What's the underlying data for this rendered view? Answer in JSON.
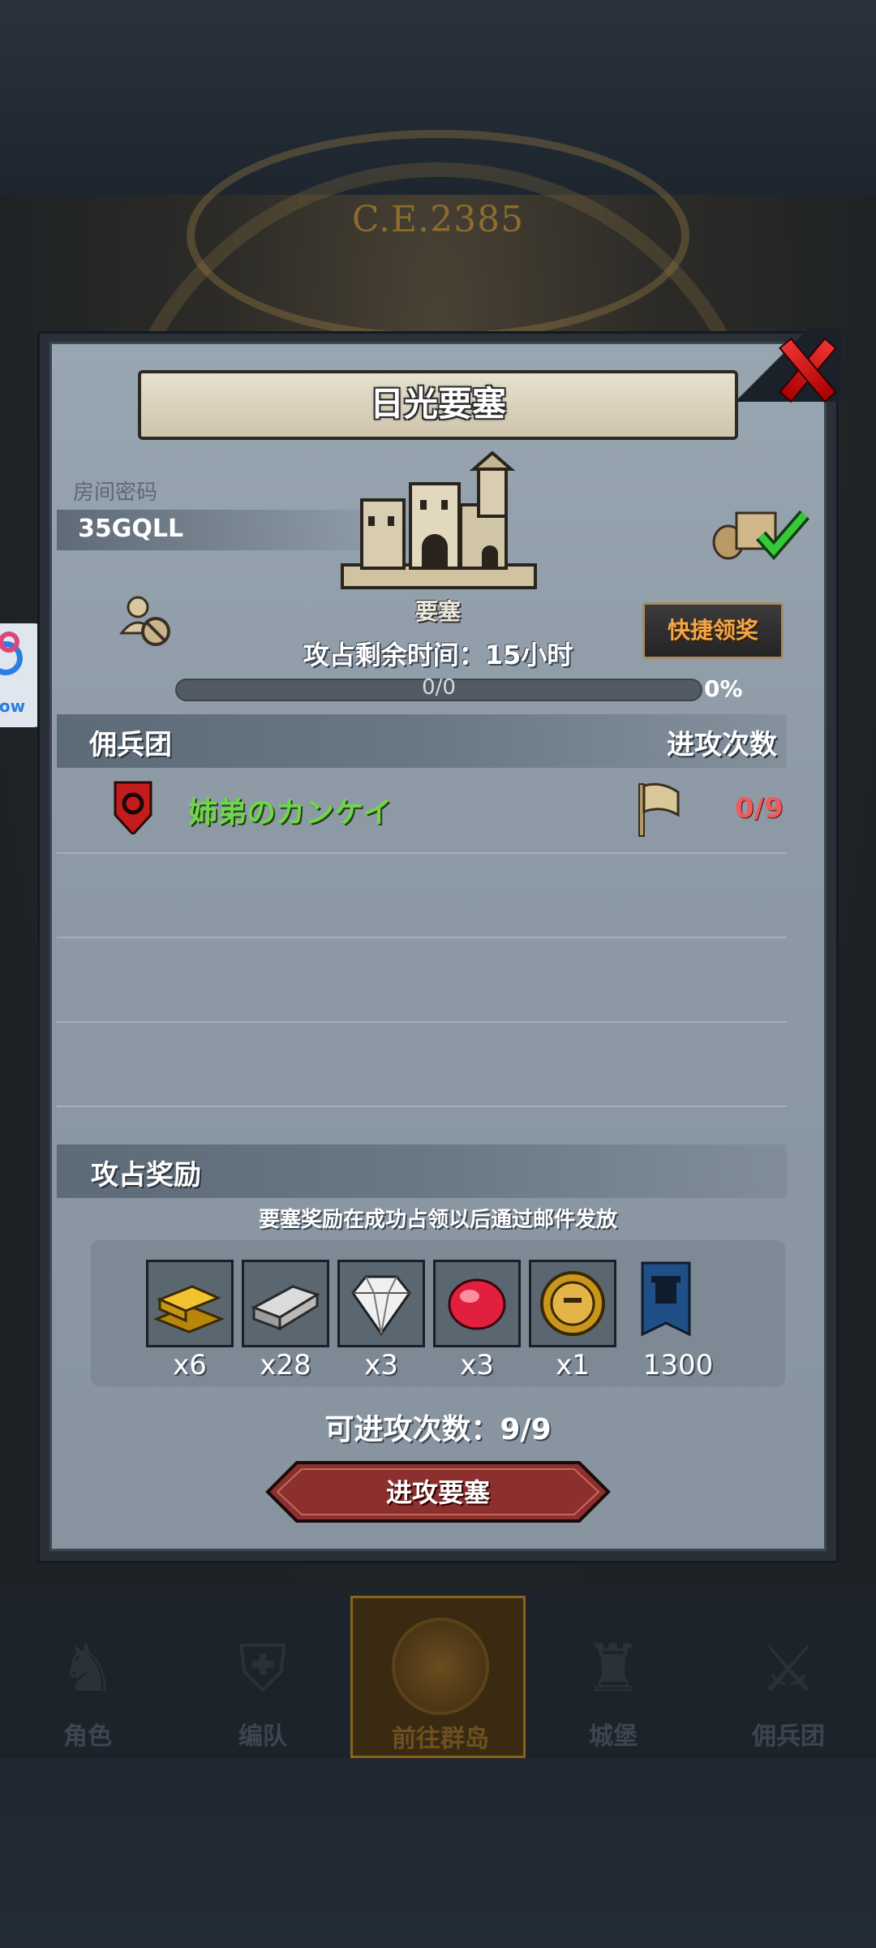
{
  "background": {
    "era_text": "C.E.2385",
    "side_button_text": "low"
  },
  "dialog": {
    "title": "日光要塞",
    "room": {
      "label": "房间密码",
      "code": "35GQLL"
    },
    "fortress_label": "要塞",
    "quick_claim_label": "快捷领奖",
    "remaining_time": "攻占剩余时间：15小时",
    "progress": {
      "text": "0/0",
      "percent_label": "0%",
      "fraction": 0
    },
    "mercenary_section": {
      "title": "佣兵团",
      "attack_count_header": "进攻次数",
      "rows": [
        {
          "name": "姉弟のカンケイ",
          "attacks": "0/9"
        }
      ]
    },
    "reward_section": {
      "title": "攻占奖励",
      "note": "要塞奖励在成功占领以后通过邮件发放",
      "items": [
        {
          "icon": "gold-bar-icon",
          "qty": "x6"
        },
        {
          "icon": "silver-bar-icon",
          "qty": "x28"
        },
        {
          "icon": "diamond-icon",
          "qty": "x3"
        },
        {
          "icon": "ruby-icon",
          "qty": "x3"
        },
        {
          "icon": "knight-coin-icon",
          "qty": "x1"
        },
        {
          "icon": "castle-banner-icon",
          "qty": "1300"
        }
      ]
    },
    "available_attacks": "可进攻次数：9/9",
    "attack_button_label": "进攻要塞"
  },
  "nav": {
    "items": [
      {
        "label": "角色",
        "active": false
      },
      {
        "label": "编队",
        "active": false
      },
      {
        "label": "前往群岛",
        "active": true
      },
      {
        "label": "城堡",
        "active": false
      },
      {
        "label": "佣兵团",
        "active": false
      }
    ]
  },
  "colors": {
    "panel": "#8d9aa6",
    "guild_name": "#6fd64a",
    "attack_count": "#ef5a5a",
    "quick_claim_text": "#f1a64a",
    "attack_button": "#8b2f2f"
  }
}
